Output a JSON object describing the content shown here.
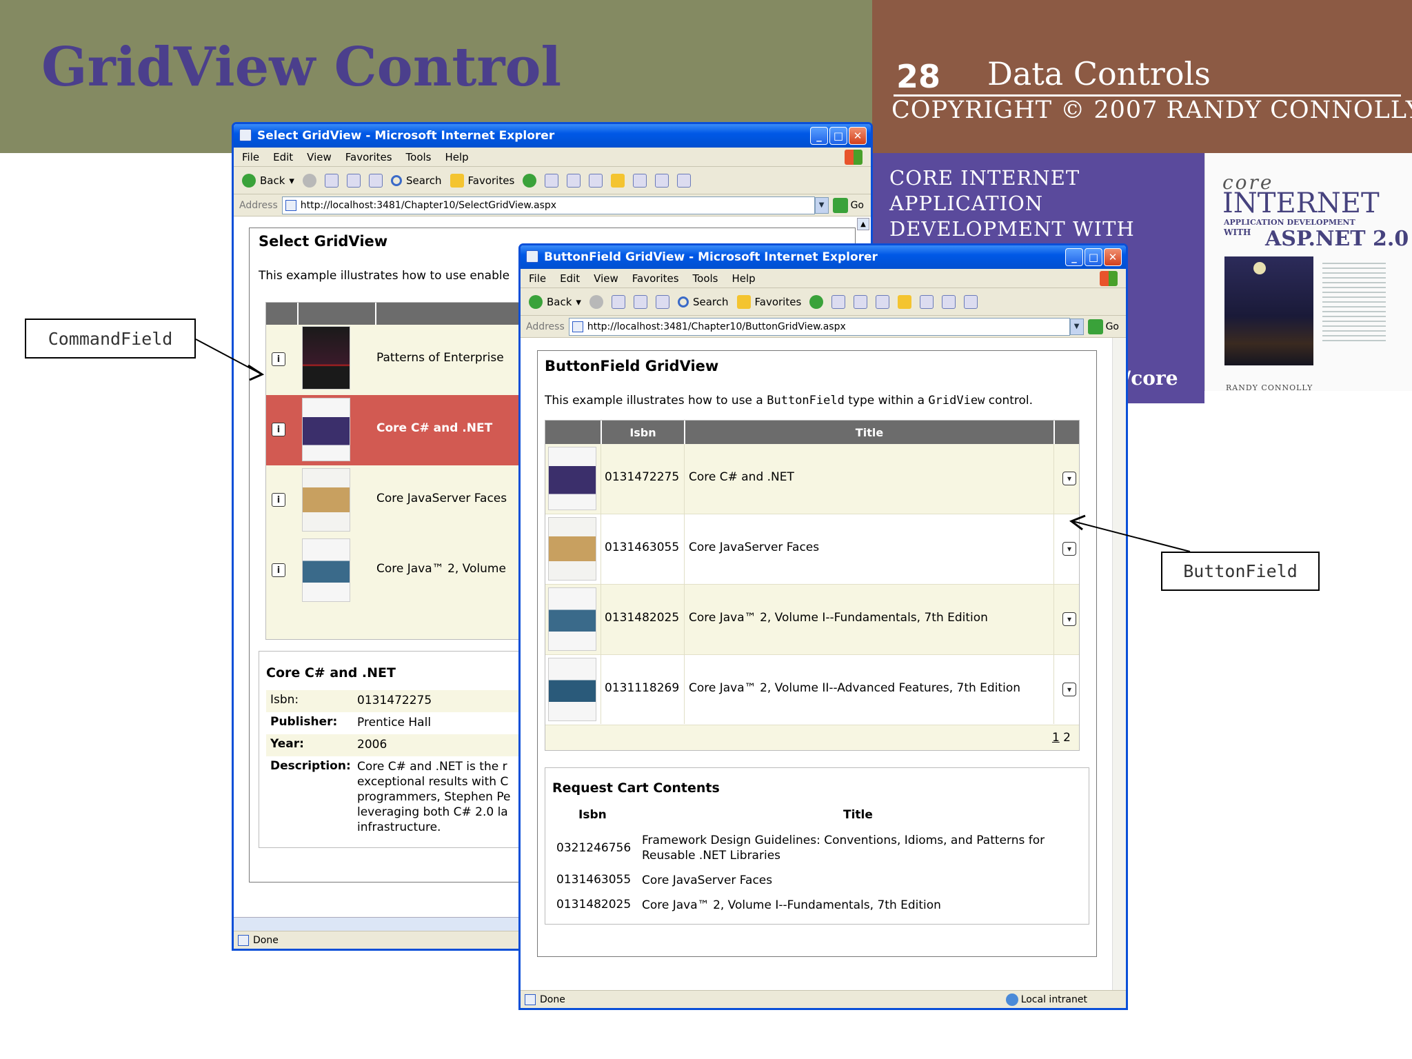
{
  "slide": {
    "title": "GridView Control",
    "number": "28",
    "chapter": "Data Controls",
    "copyright": "COPYRIGHT © 2007 RANDY CONNOLLY",
    "book_band_text": "CORE INTERNET APPLICATION DEVELOPMENT WITH",
    "book_url_fragment": "/core",
    "cover": {
      "core": "core",
      "internet": "INTERNET",
      "subtitle": "APPLICATION DEVELOPMENT",
      "with": "WITH",
      "asp": "ASP.NET 2.0",
      "author": "RANDY CONNOLLY"
    },
    "callouts": {
      "commandfield": "CommandField",
      "buttonfield": "ButtonField"
    }
  },
  "window1": {
    "title": "Select GridView - Microsoft Internet Explorer",
    "menu": [
      "File",
      "Edit",
      "View",
      "Favorites",
      "Tools",
      "Help"
    ],
    "toolbar": {
      "back": "Back",
      "search": "Search",
      "favorites": "Favorites"
    },
    "address_label": "Address",
    "address": "http://localhost:3481/Chapter10/SelectGridView.aspx",
    "go": "Go",
    "heading": "Select GridView",
    "description": "This example illustrates how to use enable",
    "rows": [
      {
        "title": "Patterns of Enterprise"
      },
      {
        "title": "Core C# and .NET",
        "selected": true
      },
      {
        "title": "Core JavaServer Faces"
      },
      {
        "title": "Core Java™ 2, Volume"
      }
    ],
    "detail": {
      "title": "Core C# and .NET",
      "isbn_label": "Isbn:",
      "isbn": "0131472275",
      "publisher_label": "Publisher:",
      "publisher": "Prentice Hall",
      "year_label": "Year:",
      "year": "2006",
      "description_label": "Description:",
      "description_lines": [
        "Core C# and .NET is the r",
        "exceptional results with C",
        "programmers, Stephen Pe",
        "leveraging both C# 2.0 la",
        "infrastructure."
      ]
    },
    "status": "Done"
  },
  "window2": {
    "title": "ButtonField GridView - Microsoft Internet Explorer",
    "menu": [
      "File",
      "Edit",
      "View",
      "Favorites",
      "Tools",
      "Help"
    ],
    "toolbar": {
      "back": "Back",
      "search": "Search",
      "favorites": "Favorites"
    },
    "address_label": "Address",
    "address": "http://localhost:3481/Chapter10/ButtonGridView.aspx",
    "go": "Go",
    "heading": "ButtonField GridView",
    "description_parts": [
      "This example illustrates how to use a ",
      "ButtonField",
      " type within a ",
      "GridView",
      " control."
    ],
    "columns": {
      "isbn": "Isbn",
      "title": "Title"
    },
    "rows": [
      {
        "isbn": "0131472275",
        "title": "Core C# and .NET"
      },
      {
        "isbn": "0131463055",
        "title": "Core JavaServer Faces"
      },
      {
        "isbn": "0131482025",
        "title": "Core Java™ 2, Volume I--Fundamentals, 7th Edition"
      },
      {
        "isbn": "0131118269",
        "title": "Core Java™ 2, Volume II--Advanced Features, 7th Edition"
      }
    ],
    "pager": {
      "page1": "1",
      "page2": "2"
    },
    "cart": {
      "title": "Request Cart Contents",
      "col_isbn": "Isbn",
      "col_title": "Title",
      "rows": [
        {
          "isbn": "0321246756",
          "title": "Framework Design Guidelines: Conventions, Idioms, and Patterns for Reusable .NET Libraries"
        },
        {
          "isbn": "0131463055",
          "title": "Core JavaServer Faces"
        },
        {
          "isbn": "0131482025",
          "title": "Core Java™ 2, Volume I--Fundamentals, 7th Edition"
        }
      ]
    },
    "status": "Done",
    "zone": "Local intranet"
  }
}
